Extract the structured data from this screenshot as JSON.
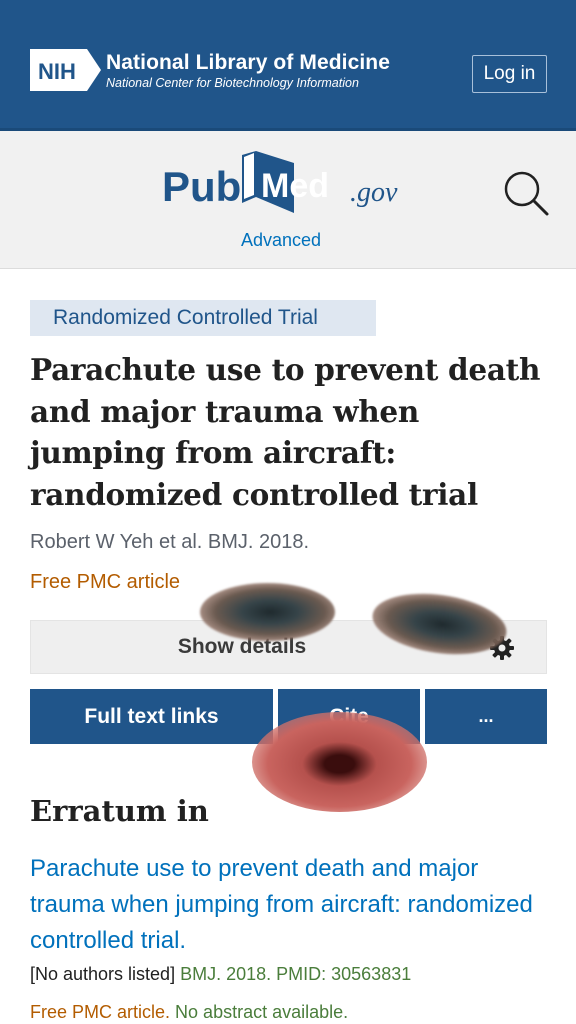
{
  "header": {
    "nih_badge": "NIH",
    "title": "National Library of Medicine",
    "subtitle": "National Center for Biotechnology Information",
    "login_label": "Log in"
  },
  "pubmed": {
    "logo_text_left": "Pub",
    "logo_text_right": "Med",
    "logo_suffix": ".gov",
    "advanced_label": "Advanced",
    "brand_color": "#20558a"
  },
  "article": {
    "type_badge": "Randomized Controlled Trial",
    "title": "Parachute use to prevent death and major trauma when jumping from aircraft: randomized controlled trial",
    "citation": "Robert W Yeh et al. BMJ. 2018.",
    "free_pmc": "Free PMC article",
    "show_details": "Show details"
  },
  "actions": {
    "full_text": "Full text links",
    "cite": "Cite",
    "more": "..."
  },
  "erratum": {
    "heading": "Erratum in",
    "link_text": "Parachute use to prevent death and major trauma when jumping from aircraft: randomized controlled trial.",
    "authors": "[No authors listed]",
    "journal_info": "BMJ. 2018. PMID: 30563831",
    "free_pmc": "Free PMC article.",
    "abstract_note": "No abstract available."
  },
  "icons": {
    "search": "search-icon",
    "settings": "gear-icon",
    "logo": "nih-logo-icon"
  },
  "colors": {
    "header_bg": "#20558a",
    "link": "#0071bc",
    "free_article": "#b35c00"
  }
}
